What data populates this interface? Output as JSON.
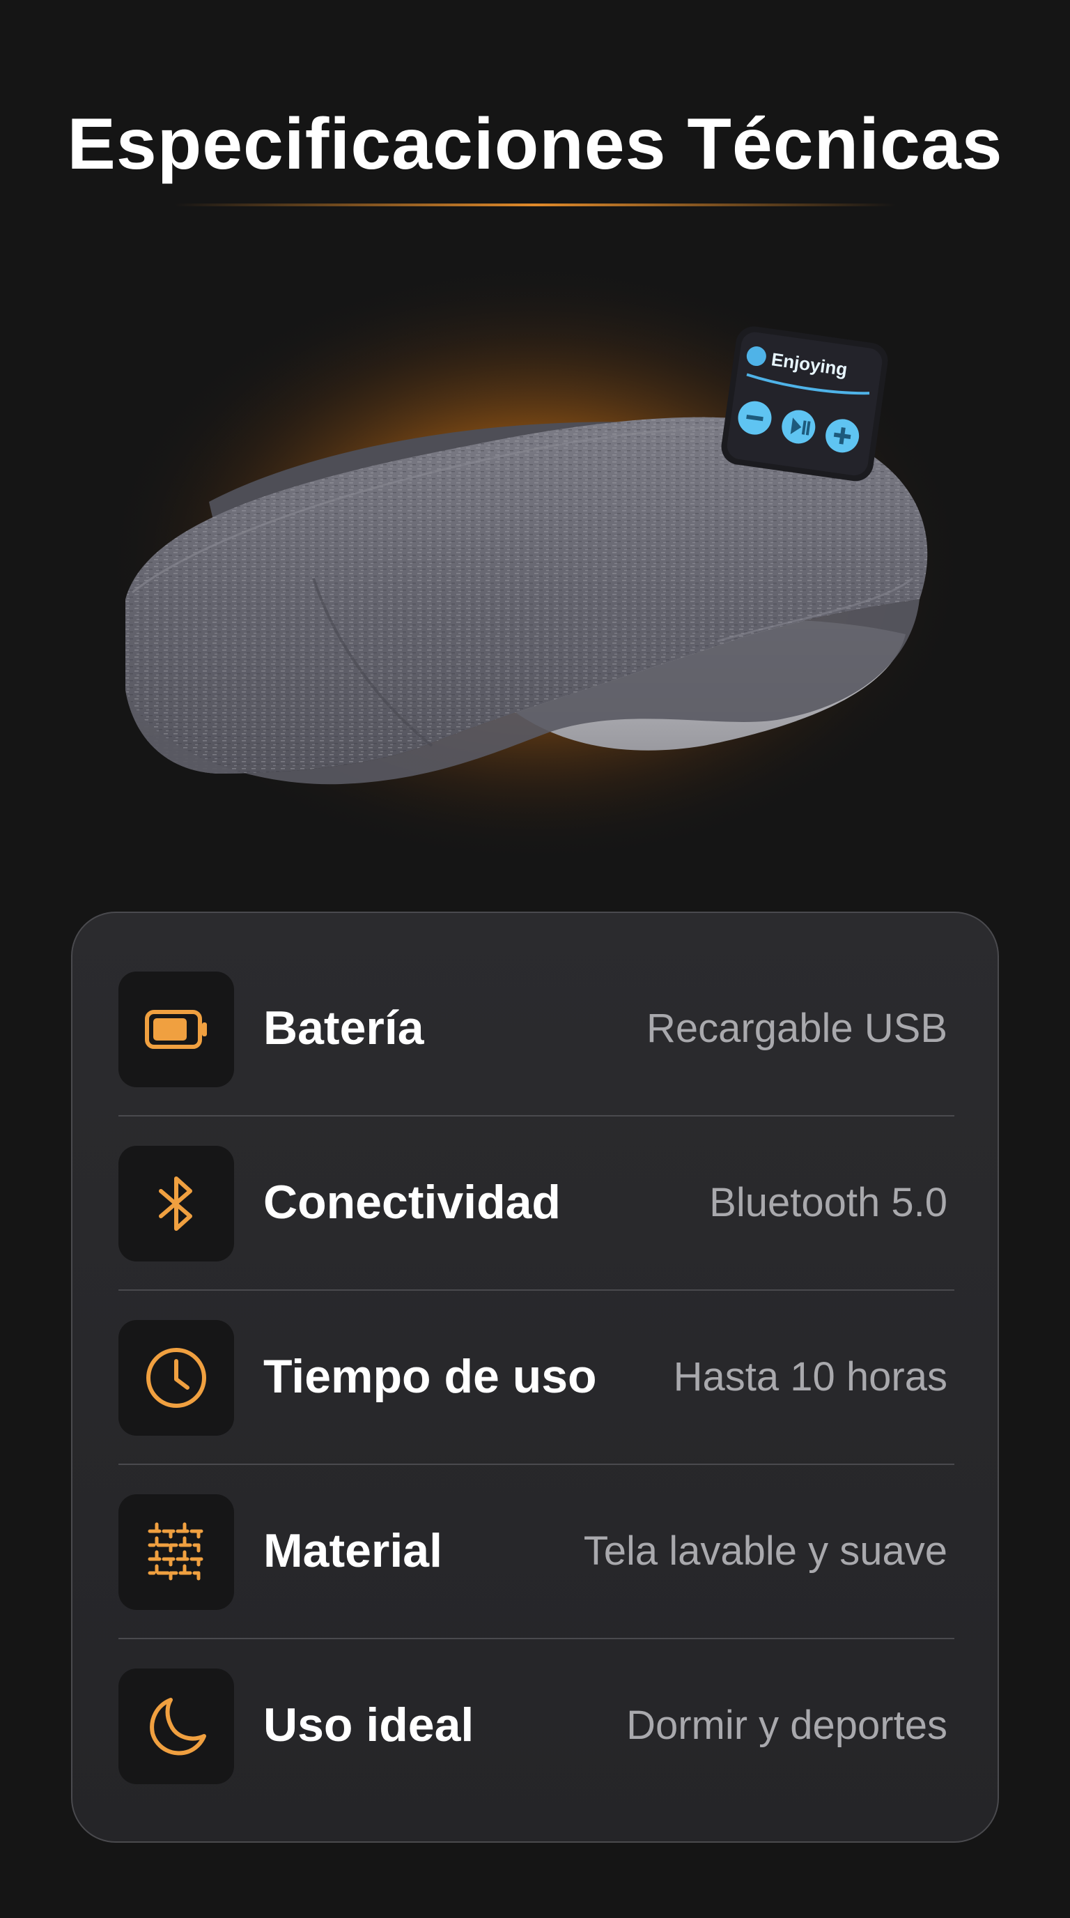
{
  "title": "Especificaciones Técnicas",
  "accent_color": "#f0a040",
  "product": {
    "image": "sleep-headband-photo",
    "panel_text": "Enjoying"
  },
  "specs": [
    {
      "icon": "battery-icon",
      "label": "Batería",
      "value": "Recargable USB"
    },
    {
      "icon": "bluetooth-icon",
      "label": "Conectividad",
      "value": "Bluetooth 5.0"
    },
    {
      "icon": "clock-icon",
      "label": "Tiempo de uso",
      "value": "Hasta 10 horas"
    },
    {
      "icon": "fabric-icon",
      "label": "Material",
      "value": "Tela lavable y suave"
    },
    {
      "icon": "moon-icon",
      "label": "Uso ideal",
      "value": "Dormir y deportes"
    }
  ]
}
